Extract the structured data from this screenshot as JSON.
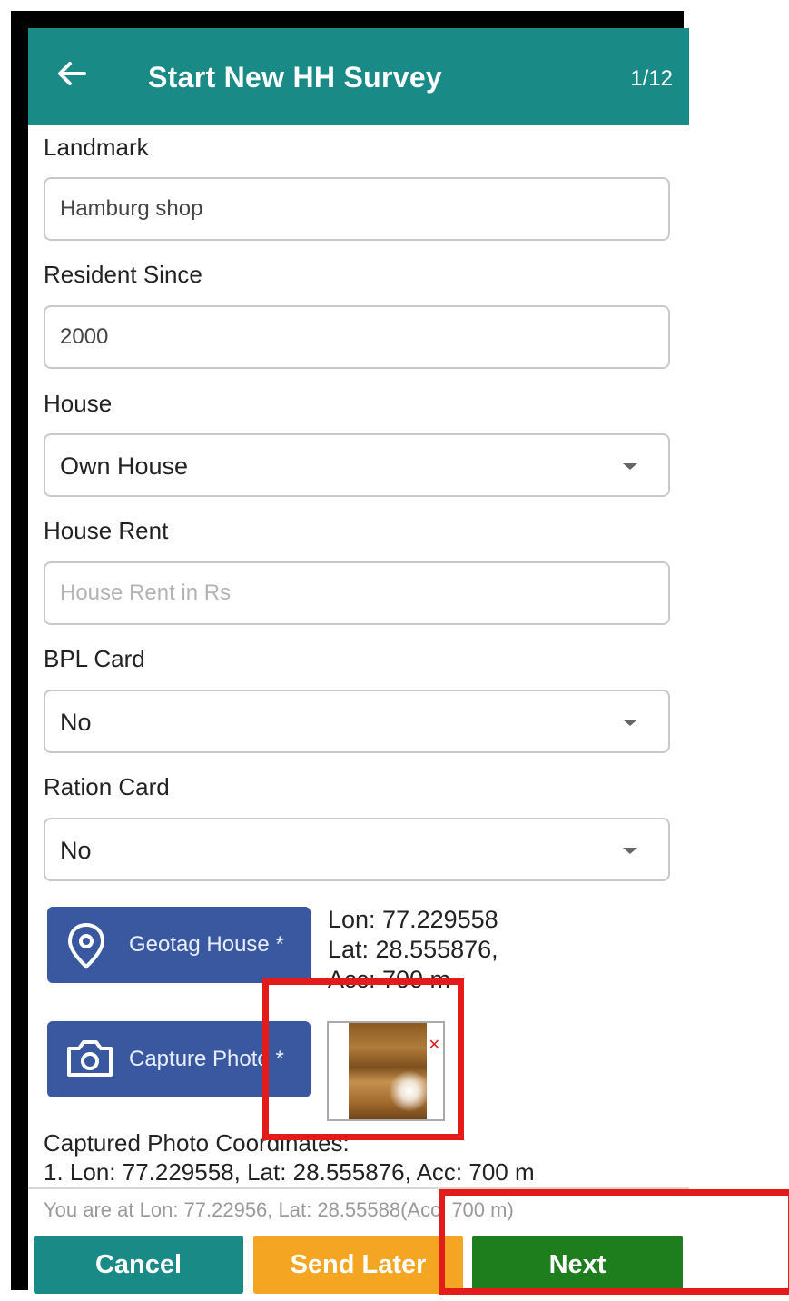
{
  "header": {
    "title": "Start New HH Survey",
    "page_indicator": "1/12"
  },
  "form": {
    "landmark": {
      "label": "Landmark",
      "value": "Hamburg shop"
    },
    "resident_since": {
      "label": "Resident Since",
      "value": "2000"
    },
    "house": {
      "label": "House",
      "value": "Own House"
    },
    "house_rent": {
      "label": "House Rent",
      "placeholder": "House Rent in Rs",
      "value": ""
    },
    "bpl_card": {
      "label": "BPL Card",
      "value": "No"
    },
    "ration_card": {
      "label": "Ration Card",
      "value": "No"
    }
  },
  "geotag": {
    "button_label": "Geotag House *",
    "lon": "Lon: 77.229558",
    "lat": "Lat: 28.555876,",
    "acc": "Acc: 700 m"
  },
  "photo": {
    "button_label": "Capture Photo *",
    "coords_title": "Captured Photo Coordinates:",
    "coords_line": "1. Lon: 77.229558, Lat: 28.555876, Acc: 700 m"
  },
  "location_status": "You are at Lon: 77.22956, Lat: 28.55588(Acc: 700 m)",
  "footer": {
    "cancel": "Cancel",
    "send_later": "Send Later",
    "next": "Next"
  },
  "colors": {
    "header": "#198a86",
    "blue_button": "#3a58a0",
    "cancel": "#198a86",
    "send_later": "#f4a521",
    "next": "#1e7e1e",
    "highlight": "#e41b1b"
  },
  "icons": {
    "back": "arrow-left-icon",
    "geotag": "location-pin-icon",
    "camera": "camera-icon",
    "remove": "close-icon"
  }
}
